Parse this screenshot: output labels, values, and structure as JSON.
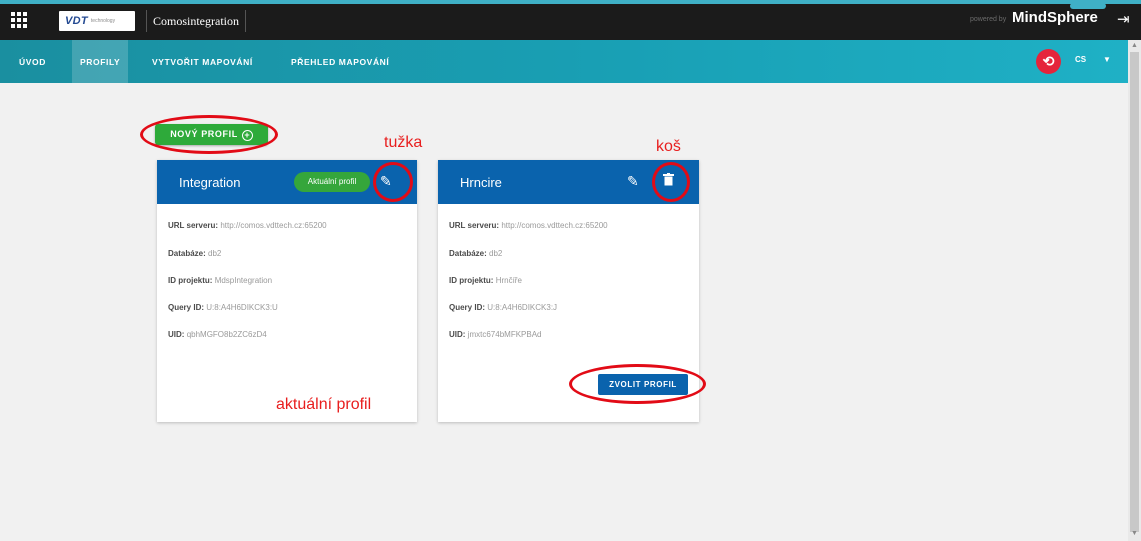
{
  "header": {
    "app_name": "Comosintegration",
    "logo_text": "VDT",
    "logo_sub": "technology",
    "powered_by": "powered by",
    "brand": "MindSphere"
  },
  "nav": {
    "items": [
      {
        "label": "ÚVOD"
      },
      {
        "label": "PROFILY"
      },
      {
        "label": "VYTVOŘIT MAPOVÁNÍ"
      },
      {
        "label": "PŘEHLED MAPOVÁNÍ"
      }
    ],
    "active_index": 1,
    "language": "CS"
  },
  "new_profile_button": "NOVÝ PROFIL",
  "profiles": [
    {
      "name": "Integration",
      "badge": "Aktuální profil",
      "fields": [
        {
          "label": "URL serveru:",
          "value": "http://comos.vdttech.cz:65200"
        },
        {
          "label": "Databáze:",
          "value": "db2"
        },
        {
          "label": "ID projektu:",
          "value": "MdspIntegration"
        },
        {
          "label": "Query ID:",
          "value": "U:8:A4H6DIKCK3:U"
        },
        {
          "label": "UID:",
          "value": "qbhMGFO8b2ZC6zD4"
        }
      ]
    },
    {
      "name": "Hrncire",
      "fields": [
        {
          "label": "URL serveru:",
          "value": "http://comos.vdttech.cz:65200"
        },
        {
          "label": "Databáze:",
          "value": "db2"
        },
        {
          "label": "ID projektu:",
          "value": "Hrnčíře"
        },
        {
          "label": "Query ID:",
          "value": "U:8:A4H6DIKCK3:J"
        },
        {
          "label": "UID:",
          "value": "jmxtc674bMFKPBAd"
        }
      ],
      "select_button": "ZVOLIT PROFIL"
    }
  ],
  "annotations": {
    "pencil": "tužka",
    "trash": "koš",
    "current": "aktuální profil"
  },
  "colors": {
    "nav_teal": "#19a0b5",
    "card_blue": "#0a63ad",
    "green": "#2eaa3a",
    "annotation_red": "#e20b16"
  },
  "icons": [
    "apps-grid-icon",
    "logout-icon",
    "refresh-icon",
    "chevron-down-icon",
    "plus-circle-icon",
    "pencil-icon",
    "trash-icon"
  ]
}
